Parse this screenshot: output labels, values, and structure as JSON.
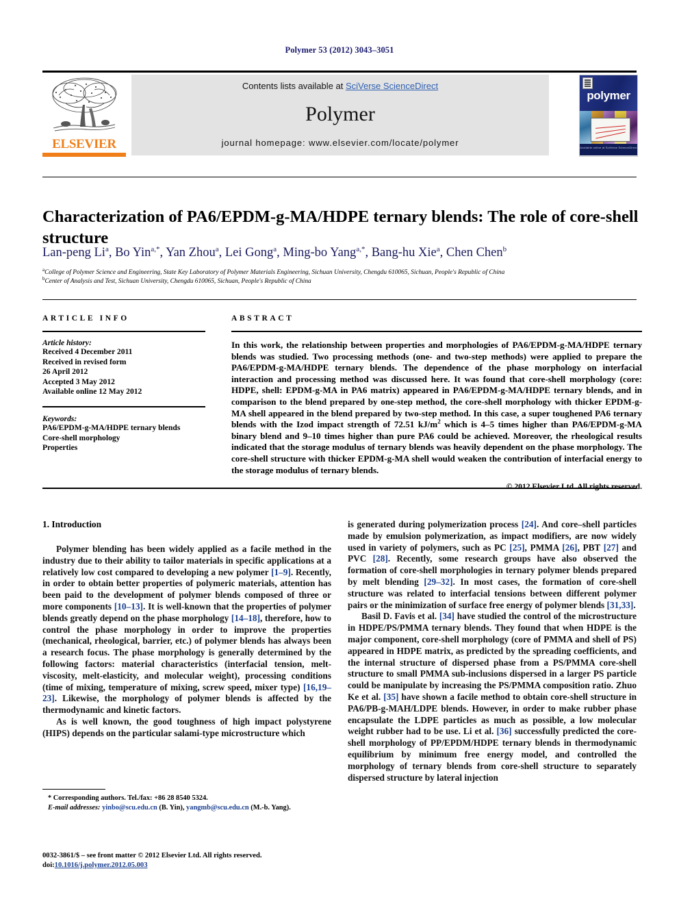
{
  "running_head": "Polymer 53 (2012) 3043–3051",
  "masthead": {
    "publisher_name": "ELSEVIER",
    "contents_prefix": "Contents lists available at ",
    "contents_link": "SciVerse ScienceDirect",
    "journal_name": "Polymer",
    "homepage": "journal homepage: www.elsevier.com/locate/polymer",
    "cover_title": "polymer",
    "cover_footer": "Available online at\nSciVerse ScienceDirect"
  },
  "article": {
    "title": "Characterization of PA6/EPDM-g-MA/HDPE ternary blends: The role of core-shell structure",
    "authors_html": "Lan-peng Li<sup>a</sup>, Bo Yin<sup>a,*</sup>, Yan Zhou<sup>a</sup>, Lei Gong<sup>a</sup>, Ming-bo Yang<sup>a,*</sup>, Bang-hu Xie<sup>a</sup>, Chen Chen<sup>b</sup>",
    "affiliation_a": "College of Polymer Science and Engineering, State Key Laboratory of Polymer Materials Engineering, Sichuan University, Chengdu 610065, Sichuan, People's Republic of China",
    "affiliation_b": "Center of Analysis and Test, Sichuan University, Chengdu 610065, Sichuan, People's Republic of China"
  },
  "info": {
    "label": "ARTICLE INFO",
    "history_heading": "Article history:",
    "history": [
      "Received 4 December 2011",
      "Received in revised form",
      "26 April 2012",
      "Accepted 3 May 2012",
      "Available online 12 May 2012"
    ],
    "keywords_heading": "Keywords:",
    "keywords": [
      "PA6/EPDM-g-MA/HDPE ternary blends",
      "Core-shell morphology",
      "Properties"
    ]
  },
  "abstract": {
    "label": "ABSTRACT",
    "text_html": "In this work, the relationship between properties and morphologies of PA6/EPDM-g-MA/HDPE ternary blends was studied. Two processing methods (one- and two-step methods) were applied to prepare the PA6/EPDM-g-MA/HDPE ternary blends. The dependence of the phase morphology on interfacial interaction and processing method was discussed here. It was found that core-shell morphology (core: HDPE, shell: EPDM-g-MA in PA6 matrix) appeared in PA6/EPDM-g-MA/HDPE ternary blends, and in comparison to the blend prepared by one-step method, the core-shell morphology with thicker EPDM-g-MA shell appeared in the blend prepared by two-step method. In this case, a super toughened PA6 ternary blends with the Izod impact strength of 72.51 kJ/m<sup>2</sup> which is 4–5 times higher than PA6/EPDM-g-MA binary blend and 9–10 times higher than pure PA6 could be achieved. Moreover, the rheological results indicated that the storage modulus of ternary blends was heavily dependent on the phase morphology. The core-shell structure with thicker EPDM-g-MA shell would weaken the contribution of interfacial energy to the storage modulus of ternary blends.",
    "copyright": "© 2012 Elsevier Ltd. All rights reserved."
  },
  "body": {
    "section_heading": "1. Introduction",
    "left_paragraphs_html": [
      "Polymer blending has been widely applied as a facile method in the industry due to their ability to tailor materials in specific applications at a relatively low cost compared to developing a new polymer <span class=\"ref\">[1–9]</span>. Recently, in order to obtain better properties of polymeric materials, attention has been paid to the development of polymer blends composed of three or more components <span class=\"ref\">[10–13]</span>. It is well-known that the properties of polymer blends greatly depend on the phase morphology <span class=\"ref\">[14–18]</span>, therefore, how to control the phase morphology in order to improve the properties (mechanical, rheological, barrier, etc.) of polymer blends has always been a research focus. The phase morphology is generally determined by the following factors: material characteristics (interfacial tension, melt-viscosity, melt-elasticity, and molecular weight), processing conditions (time of mixing, temperature of mixing, screw speed, mixer type) <span class=\"ref\">[16,19–23]</span>. Likewise, the morphology of polymer blends is affected by the thermodynamic and kinetic factors.",
      "As is well known, the good toughness of high impact polystyrene (HIPS) depends on the particular salami-type microstructure which"
    ],
    "right_paragraphs_html": [
      "is generated during polymerization process <span class=\"ref\">[24]</span>. And core–shell particles made by emulsion polymerization, as impact modifiers, are now widely used in variety of polymers, such as PC <span class=\"ref\">[25]</span>, PMMA <span class=\"ref\">[26]</span>, PBT <span class=\"ref\">[27]</span> and PVC <span class=\"ref\">[28]</span>. Recently, some research groups have also observed the formation of core-shell morphologies in ternary polymer blends prepared by melt blending <span class=\"ref\">[29–32]</span>. In most cases, the formation of core-shell structure was related to interfacial tensions between different polymer pairs or the minimization of surface free energy of polymer blends <span class=\"ref\">[31,33]</span>.",
      "Basil D. Favis et al. <span class=\"ref\">[34]</span> have studied the control of the microstructure in HDPE/PS/PMMA ternary blends. They found that when HDPE is the major component, core-shell morphology (core of PMMA and shell of PS) appeared in HDPE matrix, as predicted by the spreading coefficients, and the internal structure of dispersed phase from a PS/PMMA core-shell structure to small PMMA sub-inclusions dispersed in a larger PS particle could be manipulate by increasing the PS/PMMA composition ratio. Zhuo Ke et al. <span class=\"ref\">[35]</span> have shown a facile method to obtain core-shell structure in PA6/PB-g-MAH/LDPE blends. However, in order to make rubber phase encapsulate the LDPE particles as much as possible, a low molecular weight rubber had to be use. Li et al. <span class=\"ref\">[36]</span> successfully predicted the core-shell morphology of PP/EPDM/HDPE ternary blends in thermodynamic equilibrium by minimum free energy model, and controlled the morphology of ternary blends from core-shell structure to separately dispersed structure by lateral injection"
    ]
  },
  "footnote": {
    "corresponding_html": "* Corresponding authors. Tel./fax: +86 28 8540 5324.",
    "email_html": "<em>E-mail addresses:</em> <span class=\"mail\">yinbo@scu.edu.cn</span> (B. Yin), <span class=\"mail\">yangmb@scu.edu.cn</span> (M.-b. Yang)."
  },
  "footer": {
    "issn_line": "0032-3861/$ – see front matter © 2012 Elsevier Ltd. All rights reserved.",
    "doi_prefix": "doi:",
    "doi_value": "10.1016/j.polymer.2012.05.003"
  }
}
